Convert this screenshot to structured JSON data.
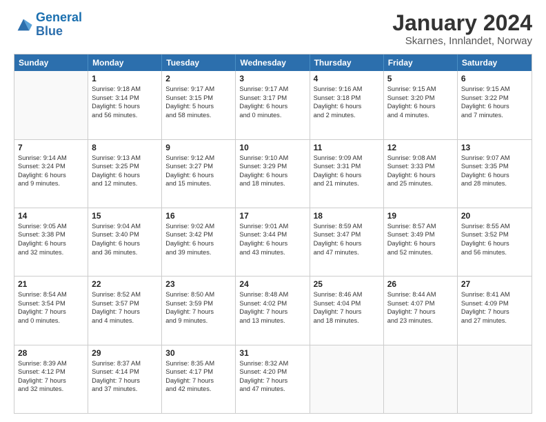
{
  "logo": {
    "text_general": "General",
    "text_blue": "Blue"
  },
  "title": "January 2024",
  "subtitle": "Skarnes, Innlandet, Norway",
  "days_of_week": [
    "Sunday",
    "Monday",
    "Tuesday",
    "Wednesday",
    "Thursday",
    "Friday",
    "Saturday"
  ],
  "weeks": [
    [
      {
        "day": "",
        "lines": []
      },
      {
        "day": "1",
        "lines": [
          "Sunrise: 9:18 AM",
          "Sunset: 3:14 PM",
          "Daylight: 5 hours",
          "and 56 minutes."
        ]
      },
      {
        "day": "2",
        "lines": [
          "Sunrise: 9:17 AM",
          "Sunset: 3:15 PM",
          "Daylight: 5 hours",
          "and 58 minutes."
        ]
      },
      {
        "day": "3",
        "lines": [
          "Sunrise: 9:17 AM",
          "Sunset: 3:17 PM",
          "Daylight: 6 hours",
          "and 0 minutes."
        ]
      },
      {
        "day": "4",
        "lines": [
          "Sunrise: 9:16 AM",
          "Sunset: 3:18 PM",
          "Daylight: 6 hours",
          "and 2 minutes."
        ]
      },
      {
        "day": "5",
        "lines": [
          "Sunrise: 9:15 AM",
          "Sunset: 3:20 PM",
          "Daylight: 6 hours",
          "and 4 minutes."
        ]
      },
      {
        "day": "6",
        "lines": [
          "Sunrise: 9:15 AM",
          "Sunset: 3:22 PM",
          "Daylight: 6 hours",
          "and 7 minutes."
        ]
      }
    ],
    [
      {
        "day": "7",
        "lines": [
          "Sunrise: 9:14 AM",
          "Sunset: 3:24 PM",
          "Daylight: 6 hours",
          "and 9 minutes."
        ]
      },
      {
        "day": "8",
        "lines": [
          "Sunrise: 9:13 AM",
          "Sunset: 3:25 PM",
          "Daylight: 6 hours",
          "and 12 minutes."
        ]
      },
      {
        "day": "9",
        "lines": [
          "Sunrise: 9:12 AM",
          "Sunset: 3:27 PM",
          "Daylight: 6 hours",
          "and 15 minutes."
        ]
      },
      {
        "day": "10",
        "lines": [
          "Sunrise: 9:10 AM",
          "Sunset: 3:29 PM",
          "Daylight: 6 hours",
          "and 18 minutes."
        ]
      },
      {
        "day": "11",
        "lines": [
          "Sunrise: 9:09 AM",
          "Sunset: 3:31 PM",
          "Daylight: 6 hours",
          "and 21 minutes."
        ]
      },
      {
        "day": "12",
        "lines": [
          "Sunrise: 9:08 AM",
          "Sunset: 3:33 PM",
          "Daylight: 6 hours",
          "and 25 minutes."
        ]
      },
      {
        "day": "13",
        "lines": [
          "Sunrise: 9:07 AM",
          "Sunset: 3:35 PM",
          "Daylight: 6 hours",
          "and 28 minutes."
        ]
      }
    ],
    [
      {
        "day": "14",
        "lines": [
          "Sunrise: 9:05 AM",
          "Sunset: 3:38 PM",
          "Daylight: 6 hours",
          "and 32 minutes."
        ]
      },
      {
        "day": "15",
        "lines": [
          "Sunrise: 9:04 AM",
          "Sunset: 3:40 PM",
          "Daylight: 6 hours",
          "and 36 minutes."
        ]
      },
      {
        "day": "16",
        "lines": [
          "Sunrise: 9:02 AM",
          "Sunset: 3:42 PM",
          "Daylight: 6 hours",
          "and 39 minutes."
        ]
      },
      {
        "day": "17",
        "lines": [
          "Sunrise: 9:01 AM",
          "Sunset: 3:44 PM",
          "Daylight: 6 hours",
          "and 43 minutes."
        ]
      },
      {
        "day": "18",
        "lines": [
          "Sunrise: 8:59 AM",
          "Sunset: 3:47 PM",
          "Daylight: 6 hours",
          "and 47 minutes."
        ]
      },
      {
        "day": "19",
        "lines": [
          "Sunrise: 8:57 AM",
          "Sunset: 3:49 PM",
          "Daylight: 6 hours",
          "and 52 minutes."
        ]
      },
      {
        "day": "20",
        "lines": [
          "Sunrise: 8:55 AM",
          "Sunset: 3:52 PM",
          "Daylight: 6 hours",
          "and 56 minutes."
        ]
      }
    ],
    [
      {
        "day": "21",
        "lines": [
          "Sunrise: 8:54 AM",
          "Sunset: 3:54 PM",
          "Daylight: 7 hours",
          "and 0 minutes."
        ]
      },
      {
        "day": "22",
        "lines": [
          "Sunrise: 8:52 AM",
          "Sunset: 3:57 PM",
          "Daylight: 7 hours",
          "and 4 minutes."
        ]
      },
      {
        "day": "23",
        "lines": [
          "Sunrise: 8:50 AM",
          "Sunset: 3:59 PM",
          "Daylight: 7 hours",
          "and 9 minutes."
        ]
      },
      {
        "day": "24",
        "lines": [
          "Sunrise: 8:48 AM",
          "Sunset: 4:02 PM",
          "Daylight: 7 hours",
          "and 13 minutes."
        ]
      },
      {
        "day": "25",
        "lines": [
          "Sunrise: 8:46 AM",
          "Sunset: 4:04 PM",
          "Daylight: 7 hours",
          "and 18 minutes."
        ]
      },
      {
        "day": "26",
        "lines": [
          "Sunrise: 8:44 AM",
          "Sunset: 4:07 PM",
          "Daylight: 7 hours",
          "and 23 minutes."
        ]
      },
      {
        "day": "27",
        "lines": [
          "Sunrise: 8:41 AM",
          "Sunset: 4:09 PM",
          "Daylight: 7 hours",
          "and 27 minutes."
        ]
      }
    ],
    [
      {
        "day": "28",
        "lines": [
          "Sunrise: 8:39 AM",
          "Sunset: 4:12 PM",
          "Daylight: 7 hours",
          "and 32 minutes."
        ]
      },
      {
        "day": "29",
        "lines": [
          "Sunrise: 8:37 AM",
          "Sunset: 4:14 PM",
          "Daylight: 7 hours",
          "and 37 minutes."
        ]
      },
      {
        "day": "30",
        "lines": [
          "Sunrise: 8:35 AM",
          "Sunset: 4:17 PM",
          "Daylight: 7 hours",
          "and 42 minutes."
        ]
      },
      {
        "day": "31",
        "lines": [
          "Sunrise: 8:32 AM",
          "Sunset: 4:20 PM",
          "Daylight: 7 hours",
          "and 47 minutes."
        ]
      },
      {
        "day": "",
        "lines": []
      },
      {
        "day": "",
        "lines": []
      },
      {
        "day": "",
        "lines": []
      }
    ]
  ]
}
